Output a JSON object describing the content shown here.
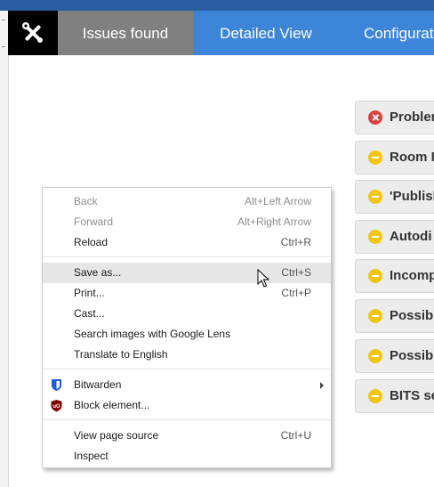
{
  "navbar": {
    "logo_icon": "tools-icon",
    "tabs": [
      {
        "label": "Issues found",
        "active": true
      },
      {
        "label": "Detailed View",
        "active": false
      },
      {
        "label": "Configuration",
        "active": false
      }
    ]
  },
  "issues": [
    {
      "label": "Problem",
      "severity": "error"
    },
    {
      "label": "Room I",
      "severity": "warning"
    },
    {
      "label": "'Publish",
      "severity": "warning"
    },
    {
      "label": "Autodi",
      "severity": "warning"
    },
    {
      "label": "Incomp",
      "severity": "warning"
    },
    {
      "label": "Possibl",
      "severity": "warning"
    },
    {
      "label": "Possibl",
      "severity": "warning"
    },
    {
      "label": "BITS se",
      "severity": "warning"
    }
  ],
  "context_menu": {
    "back": {
      "label": "Back",
      "shortcut": "Alt+Left Arrow"
    },
    "forward": {
      "label": "Forward",
      "shortcut": "Alt+Right Arrow"
    },
    "reload": {
      "label": "Reload",
      "shortcut": "Ctrl+R"
    },
    "save_as": {
      "label": "Save as...",
      "shortcut": "Ctrl+S"
    },
    "print": {
      "label": "Print...",
      "shortcut": "Ctrl+P"
    },
    "cast": {
      "label": "Cast..."
    },
    "search_lens": {
      "label": "Search images with Google Lens"
    },
    "translate": {
      "label": "Translate to English"
    },
    "bitwarden": {
      "label": "Bitwarden",
      "icon": "bitwarden-shield-icon"
    },
    "block_element": {
      "label": "Block element...",
      "icon": "ublock-origin-icon"
    },
    "view_source": {
      "label": "View page source",
      "shortcut": "Ctrl+U"
    },
    "inspect": {
      "label": "Inspect"
    }
  },
  "colors": {
    "navbar": "#3c85d9",
    "active_tab": "#808080",
    "error": "#d9403e",
    "warning": "#f3c614"
  }
}
